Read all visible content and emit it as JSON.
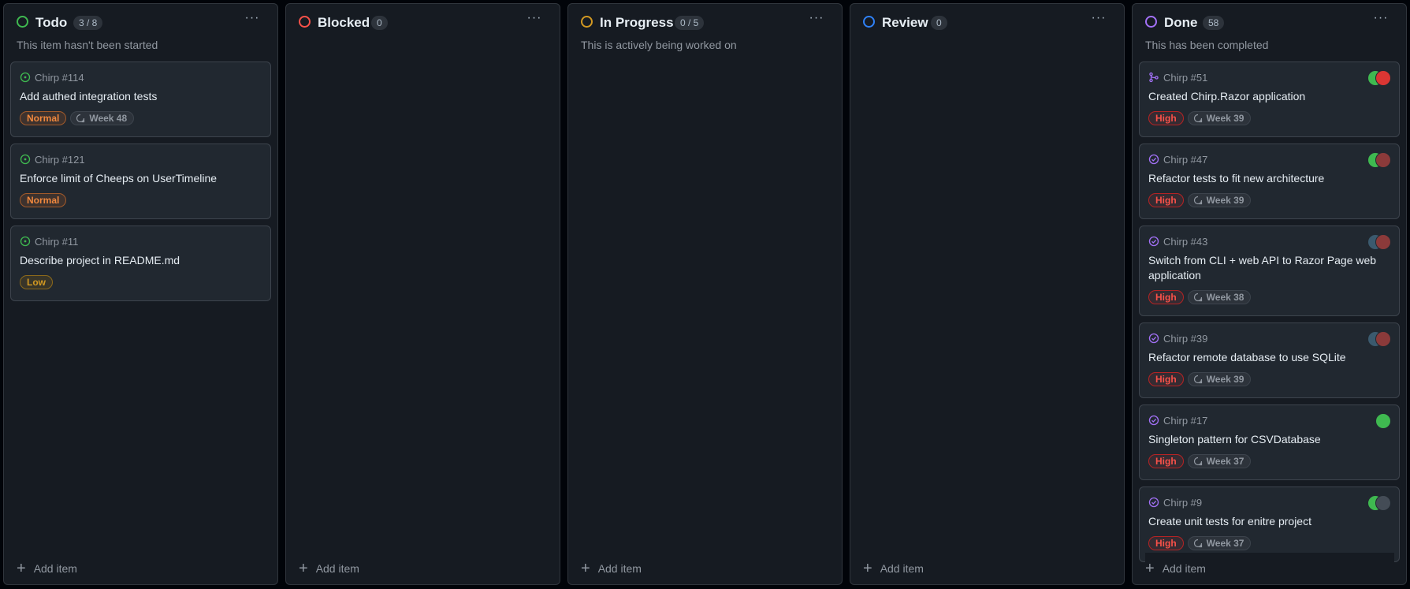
{
  "columns": [
    {
      "title": "Todo",
      "count": "3 / 8",
      "description": "This item hasn't been started",
      "status_color": "#3fb950",
      "add_label": "Add item",
      "cards": [
        {
          "ref": "Chirp #114",
          "title": "Add authed integration tests",
          "priority": "Normal",
          "iteration": "Week 48"
        },
        {
          "ref": "Chirp #121",
          "title": "Enforce limit of Cheeps on UserTimeline",
          "priority": "Normal",
          "iteration": ""
        },
        {
          "ref": "Chirp #11",
          "title": "Describe project in README.md",
          "priority": "Low",
          "iteration": ""
        }
      ]
    },
    {
      "title": "Blocked",
      "count": "0",
      "description": "",
      "status_color": "#f85149",
      "add_label": "Add item",
      "cards": []
    },
    {
      "title": "In Progress",
      "count": "0 / 5",
      "description": "This is actively being worked on",
      "status_color": "#d29922",
      "add_label": "Add item",
      "cards": []
    },
    {
      "title": "Review",
      "count": "0",
      "description": "",
      "status_color": "#2f81f7",
      "add_label": "Add item",
      "cards": []
    },
    {
      "title": "Done",
      "count": "58",
      "description": "This has been completed",
      "status_color": "#a371f7",
      "add_label": "Add item",
      "cards": [
        {
          "ref": "Chirp #51",
          "title": "Created Chirp.Razor application",
          "priority": "High",
          "iteration": "Week 39"
        },
        {
          "ref": "Chirp #47",
          "title": "Refactor tests to fit new architecture",
          "priority": "High",
          "iteration": "Week 39"
        },
        {
          "ref": "Chirp #43",
          "title": "Switch from CLI + web API to Razor Page web application",
          "priority": "High",
          "iteration": "Week 38"
        },
        {
          "ref": "Chirp #39",
          "title": "Refactor remote database to use SQLite",
          "priority": "High",
          "iteration": "Week 39"
        },
        {
          "ref": "Chirp #17",
          "title": "Singleton pattern for CSVDatabase",
          "priority": "High",
          "iteration": "Week 37"
        },
        {
          "ref": "Chirp #9",
          "title": "Create unit tests for enitre project",
          "priority": "High",
          "iteration": "Week 37"
        }
      ]
    }
  ],
  "icons": {
    "open_issue": "open-issue-icon",
    "closed_issue": "closed-issue-icon",
    "merged_pr": "merged-pr-icon",
    "iteration": "iteration-icon",
    "more": "kebab-horizontal-icon",
    "add": "plus-icon"
  }
}
